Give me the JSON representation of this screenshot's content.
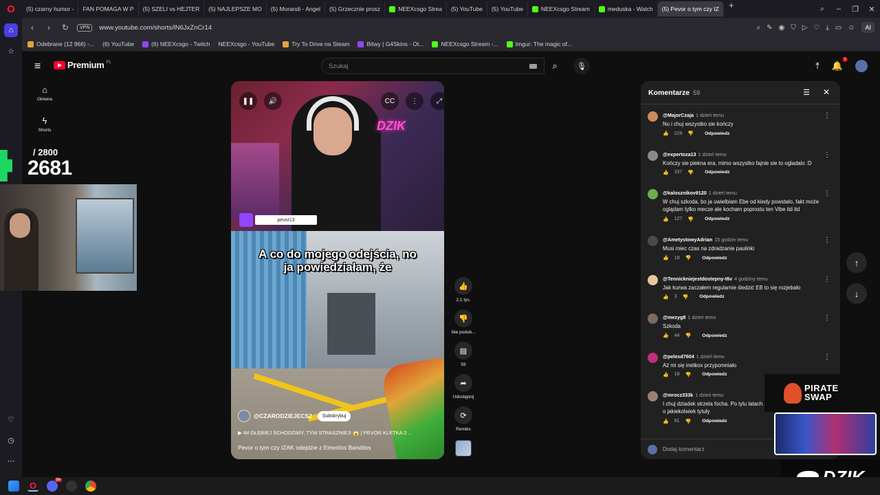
{
  "browser": {
    "tabs": [
      {
        "label": "(5) czarny humor -",
        "fav": "yt"
      },
      {
        "label": "FAN POMAGA W P",
        "fav": "yt"
      },
      {
        "label": "(5) SZELI vs HEJTER",
        "fav": "yt"
      },
      {
        "label": "(5) NAJLEPSZE MO",
        "fav": "yt"
      },
      {
        "label": "(5) Morandi - Angel",
        "fav": "yt"
      },
      {
        "label": "(5) Grzecznie prosz",
        "fav": "yt"
      },
      {
        "label": "NEEXcsgo Strea",
        "fav": "kick"
      },
      {
        "label": "(5) YouTube",
        "fav": "yt"
      },
      {
        "label": "(5) YouTube",
        "fav": "yt"
      },
      {
        "label": "NEEXcsgo Stream",
        "fav": "kick"
      },
      {
        "label": "meduska - Watch",
        "fav": "kick"
      },
      {
        "label": "(5) Pevor o tym czy IZ",
        "fav": "yt",
        "active": true
      }
    ],
    "url": "www.youtube.com/shorts/lN6JxZnCr14",
    "vpn": "VPN",
    "ai_label": "AI",
    "bookmarks": [
      {
        "label": "Odebrane (12 966) -...",
        "fav": "misc"
      },
      {
        "label": "(6) YouTube",
        "fav": "yt"
      },
      {
        "label": "(6) NEEXcsgo - Twitch",
        "fav": "twitch"
      },
      {
        "label": "NEEXcsgo - YouTube",
        "fav": "yt"
      },
      {
        "label": "Try To Drive na Steam",
        "fav": "misc"
      },
      {
        "label": "Bitwy | G4Skins - Ot...",
        "fav": "twitch"
      },
      {
        "label": "NEEXcsgo Stream -...",
        "fav": "kick"
      },
      {
        "label": "Imgur: The magic of...",
        "fav": "kick"
      }
    ]
  },
  "yt": {
    "logo": "Premium",
    "region": "PL",
    "search_placeholder": "Szukaj",
    "notif_count": "5",
    "nav": [
      {
        "label": "Główna",
        "icon": "home-icon"
      },
      {
        "label": "Shorts",
        "icon": "shorts-icon"
      }
    ]
  },
  "overlay": {
    "counter_total": "/ 2800",
    "counter_value": "2681"
  },
  "video": {
    "twitch_name": "pevor13",
    "caption": "A co do mojego odejścia, no ja powiedziałam, że",
    "channel": "@CZARODZIEJECS2",
    "subscribe": "Subskrybuj",
    "music": "▶  IM GŁĘBIEJ SCHODZIMY, TYM STRASZNIEJ! 😱 | PEVOR KLETKA 2 ...",
    "title": "Pevor o tym czy IZAK odejdzie z Emeritos Banditos",
    "dzik": "DZIK"
  },
  "actions": {
    "like_count": "2,1 tys.",
    "dislike_label": "Nie podob...",
    "comment_count": "59",
    "share_label": "Udostępnij",
    "remix_label": "Remiks"
  },
  "comments": {
    "title": "Komentarze",
    "count": "59",
    "add_placeholder": "Dodaj komentarz",
    "reply_label": "Odpowiedz",
    "items": [
      {
        "user": "@MajorCzaja",
        "time": "1 dzień temu",
        "text": "No i chuj wszystko sie kończy",
        "likes": "229",
        "color": "#c98b5a"
      },
      {
        "user": "@expertoza13",
        "time": "1 dzień temu",
        "text": "Kończy sie piekna era, mimo wszystko fajnie sie to ogladalo :D",
        "likes": "337",
        "color": "#8a8a8a"
      },
      {
        "user": "@kalosznikov9120",
        "time": "1 dzień temu",
        "text": "W chuj szkoda, bo ja uwielbiam Ebe od kiedy powstalo, fakt może oglądam tylko mecze ale kocham poprostu ten Vibe itd itd",
        "likes": "127",
        "color": "#6fae4a"
      },
      {
        "user": "@AmetystowyAdrian",
        "time": "15 godzin temu",
        "text": "Musi miec czas na zdradzanie paulinki",
        "likes": "18",
        "color": "#4a4a4a"
      },
      {
        "user": "@Tennickniejestdostepny-t6v",
        "time": "4 godziny temu",
        "text": "Jak kurwa zaczałem regularnie śledzić EB to się rozjebało",
        "likes": "3",
        "color": "#e8c6a0"
      },
      {
        "user": "@mezyg8",
        "time": "1 dzień temu",
        "text": "Szkoda",
        "likes": "44",
        "color": "#7a6a60"
      },
      {
        "user": "@pelexd7604",
        "time": "1 dzień temu",
        "text": "Aż mi się inetkox przypomniało",
        "likes": "18",
        "color": "#c0307a"
      },
      {
        "user": "@mrocz333k",
        "time": "1 dzień temu",
        "text": "I chuj dziadek strzela focha. Po tylu latach zachciało mu sie walczyc o jakiekolwiek tytuły",
        "likes": "81",
        "color": "#9a8070"
      }
    ]
  },
  "sponsor": {
    "line1": "PIRATE",
    "line2": "SWAP",
    "banner": "DZIK"
  },
  "taskbar": {
    "discord_badge": "9+"
  },
  "colors": {
    "accent_red": "#ff0033",
    "kick_green": "#53fc18",
    "twitch_purple": "#9146ff",
    "opera_red": "#ff1b2d"
  }
}
